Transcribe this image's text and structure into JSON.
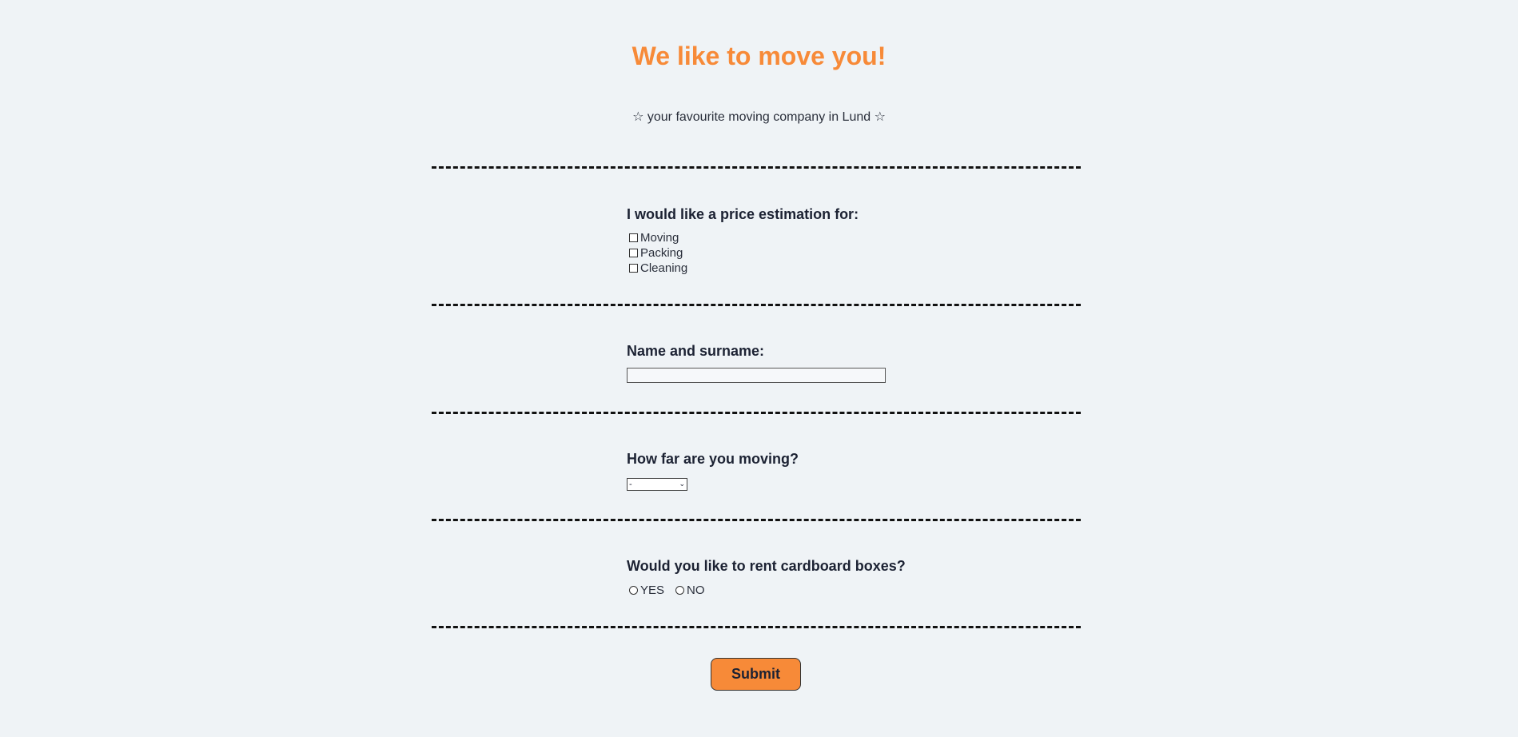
{
  "header": {
    "title": "We like to move you!",
    "tagline": "☆ your favourite moving company in Lund ☆"
  },
  "services": {
    "label": "I would like a price estimation for:",
    "options": [
      "Moving",
      "Packing",
      "Cleaning"
    ]
  },
  "name": {
    "label": "Name and surname:",
    "value": ""
  },
  "distance": {
    "label": "How far are you moving?",
    "selected": "-"
  },
  "boxes": {
    "label": "Would you like to rent cardboard boxes?",
    "options": [
      "YES",
      "NO"
    ]
  },
  "submit_label": "Submit",
  "colors": {
    "accent": "#f78a38",
    "background": "#eff3f6",
    "text": "#1c2233"
  }
}
